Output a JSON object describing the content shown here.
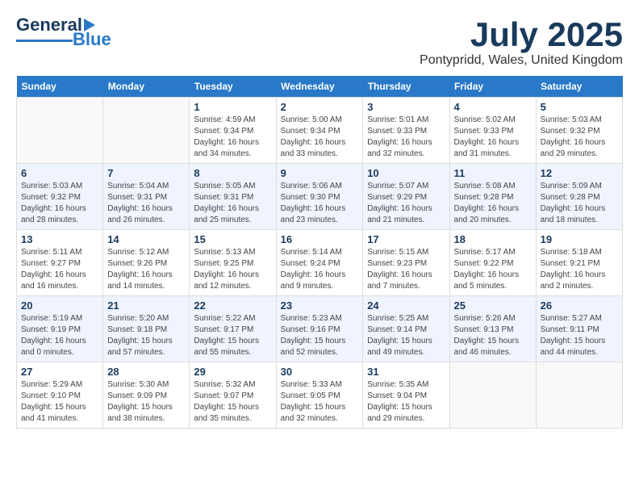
{
  "header": {
    "logo_general": "General",
    "logo_blue": "Blue",
    "month_title": "July 2025",
    "location": "Pontypridd, Wales, United Kingdom"
  },
  "days_of_week": [
    "Sunday",
    "Monday",
    "Tuesday",
    "Wednesday",
    "Thursday",
    "Friday",
    "Saturday"
  ],
  "weeks": [
    [
      {
        "day": "",
        "details": ""
      },
      {
        "day": "",
        "details": ""
      },
      {
        "day": "1",
        "details": "Sunrise: 4:59 AM\nSunset: 9:34 PM\nDaylight: 16 hours\nand 34 minutes."
      },
      {
        "day": "2",
        "details": "Sunrise: 5:00 AM\nSunset: 9:34 PM\nDaylight: 16 hours\nand 33 minutes."
      },
      {
        "day": "3",
        "details": "Sunrise: 5:01 AM\nSunset: 9:33 PM\nDaylight: 16 hours\nand 32 minutes."
      },
      {
        "day": "4",
        "details": "Sunrise: 5:02 AM\nSunset: 9:33 PM\nDaylight: 16 hours\nand 31 minutes."
      },
      {
        "day": "5",
        "details": "Sunrise: 5:03 AM\nSunset: 9:32 PM\nDaylight: 16 hours\nand 29 minutes."
      }
    ],
    [
      {
        "day": "6",
        "details": "Sunrise: 5:03 AM\nSunset: 9:32 PM\nDaylight: 16 hours\nand 28 minutes."
      },
      {
        "day": "7",
        "details": "Sunrise: 5:04 AM\nSunset: 9:31 PM\nDaylight: 16 hours\nand 26 minutes."
      },
      {
        "day": "8",
        "details": "Sunrise: 5:05 AM\nSunset: 9:31 PM\nDaylight: 16 hours\nand 25 minutes."
      },
      {
        "day": "9",
        "details": "Sunrise: 5:06 AM\nSunset: 9:30 PM\nDaylight: 16 hours\nand 23 minutes."
      },
      {
        "day": "10",
        "details": "Sunrise: 5:07 AM\nSunset: 9:29 PM\nDaylight: 16 hours\nand 21 minutes."
      },
      {
        "day": "11",
        "details": "Sunrise: 5:08 AM\nSunset: 9:28 PM\nDaylight: 16 hours\nand 20 minutes."
      },
      {
        "day": "12",
        "details": "Sunrise: 5:09 AM\nSunset: 9:28 PM\nDaylight: 16 hours\nand 18 minutes."
      }
    ],
    [
      {
        "day": "13",
        "details": "Sunrise: 5:11 AM\nSunset: 9:27 PM\nDaylight: 16 hours\nand 16 minutes."
      },
      {
        "day": "14",
        "details": "Sunrise: 5:12 AM\nSunset: 9:26 PM\nDaylight: 16 hours\nand 14 minutes."
      },
      {
        "day": "15",
        "details": "Sunrise: 5:13 AM\nSunset: 9:25 PM\nDaylight: 16 hours\nand 12 minutes."
      },
      {
        "day": "16",
        "details": "Sunrise: 5:14 AM\nSunset: 9:24 PM\nDaylight: 16 hours\nand 9 minutes."
      },
      {
        "day": "17",
        "details": "Sunrise: 5:15 AM\nSunset: 9:23 PM\nDaylight: 16 hours\nand 7 minutes."
      },
      {
        "day": "18",
        "details": "Sunrise: 5:17 AM\nSunset: 9:22 PM\nDaylight: 16 hours\nand 5 minutes."
      },
      {
        "day": "19",
        "details": "Sunrise: 5:18 AM\nSunset: 9:21 PM\nDaylight: 16 hours\nand 2 minutes."
      }
    ],
    [
      {
        "day": "20",
        "details": "Sunrise: 5:19 AM\nSunset: 9:19 PM\nDaylight: 16 hours\nand 0 minutes."
      },
      {
        "day": "21",
        "details": "Sunrise: 5:20 AM\nSunset: 9:18 PM\nDaylight: 15 hours\nand 57 minutes."
      },
      {
        "day": "22",
        "details": "Sunrise: 5:22 AM\nSunset: 9:17 PM\nDaylight: 15 hours\nand 55 minutes."
      },
      {
        "day": "23",
        "details": "Sunrise: 5:23 AM\nSunset: 9:16 PM\nDaylight: 15 hours\nand 52 minutes."
      },
      {
        "day": "24",
        "details": "Sunrise: 5:25 AM\nSunset: 9:14 PM\nDaylight: 15 hours\nand 49 minutes."
      },
      {
        "day": "25",
        "details": "Sunrise: 5:26 AM\nSunset: 9:13 PM\nDaylight: 15 hours\nand 46 minutes."
      },
      {
        "day": "26",
        "details": "Sunrise: 5:27 AM\nSunset: 9:11 PM\nDaylight: 15 hours\nand 44 minutes."
      }
    ],
    [
      {
        "day": "27",
        "details": "Sunrise: 5:29 AM\nSunset: 9:10 PM\nDaylight: 15 hours\nand 41 minutes."
      },
      {
        "day": "28",
        "details": "Sunrise: 5:30 AM\nSunset: 9:09 PM\nDaylight: 15 hours\nand 38 minutes."
      },
      {
        "day": "29",
        "details": "Sunrise: 5:32 AM\nSunset: 9:07 PM\nDaylight: 15 hours\nand 35 minutes."
      },
      {
        "day": "30",
        "details": "Sunrise: 5:33 AM\nSunset: 9:05 PM\nDaylight: 15 hours\nand 32 minutes."
      },
      {
        "day": "31",
        "details": "Sunrise: 5:35 AM\nSunset: 9:04 PM\nDaylight: 15 hours\nand 29 minutes."
      },
      {
        "day": "",
        "details": ""
      },
      {
        "day": "",
        "details": ""
      }
    ]
  ]
}
